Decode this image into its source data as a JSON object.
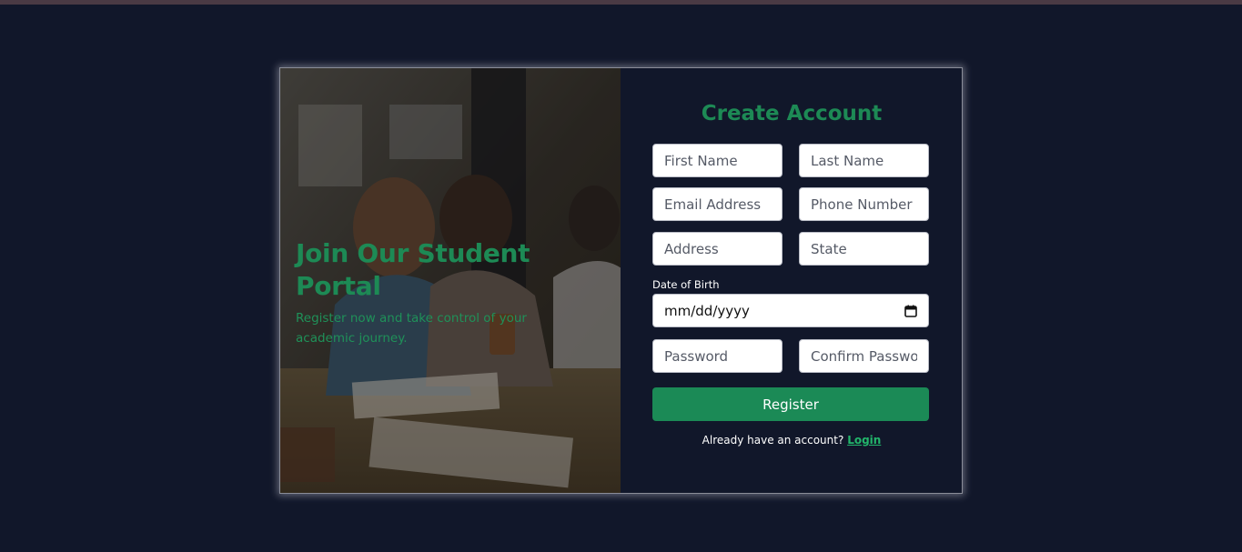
{
  "hero": {
    "title": "Join Our Student Portal",
    "subtitle": "Register now and take control of your academic journey."
  },
  "form": {
    "title": "Create Account",
    "first_name": {
      "placeholder": "First Name"
    },
    "last_name": {
      "placeholder": "Last Name"
    },
    "email": {
      "placeholder": "Email Address"
    },
    "phone": {
      "placeholder": "Phone Number"
    },
    "address": {
      "placeholder": "Address"
    },
    "state": {
      "placeholder": "State"
    },
    "dob_label": "Date of Birth",
    "dob_value": "mm/dd/yyyy",
    "password": {
      "placeholder": "Password"
    },
    "confirm_password": {
      "placeholder": "Confirm Password"
    },
    "register_label": "Register",
    "login_prompt": "Already have an account?",
    "login_link": "Login"
  },
  "colors": {
    "background": "#11172a",
    "accent": "#1b8a56",
    "link": "#22b56b"
  },
  "icons": {
    "date_picker": "calendar-icon"
  }
}
